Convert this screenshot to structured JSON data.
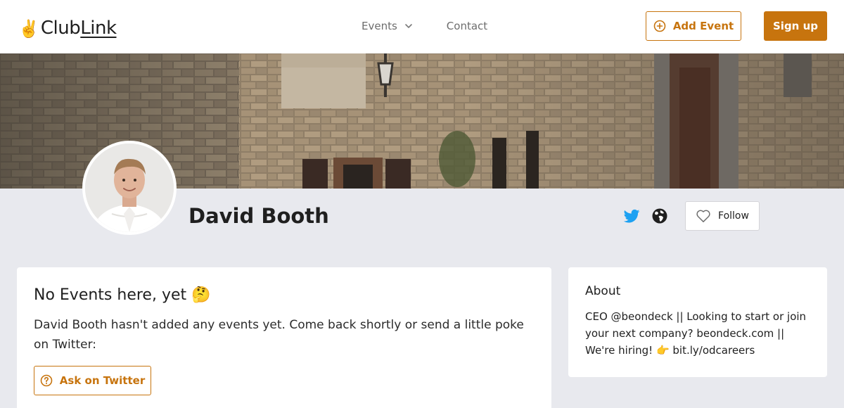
{
  "header": {
    "logo_mark": "✌️",
    "logo_part1": "Club",
    "logo_part2": "Link",
    "nav": {
      "events": "Events",
      "contact": "Contact"
    },
    "add_event_label": "Add Event",
    "signup_label": "Sign up"
  },
  "profile": {
    "name": "David Booth",
    "follow_label": "Follow"
  },
  "events_card": {
    "title": "No Events here, yet 🤔",
    "message": "David Booth hasn't added any events yet. Come back shortly or send a little poke on Twitter:",
    "ask_label": "Ask on Twitter"
  },
  "about_card": {
    "title": "About",
    "bio": "CEO @beondeck || Looking to start or join your next company? beondeck.com || We're hiring! 👉 bit.ly/odcareers"
  },
  "colors": {
    "accent": "#c7740e",
    "page_background": "#e8e9ee",
    "twitter_blue": "#1da1f2"
  },
  "icons": {
    "add_event": "plus-circle-icon",
    "events_chevron": "chevron-down-icon",
    "twitter": "twitter-icon",
    "website": "globe-icon",
    "follow": "heart-icon",
    "ask": "question-circle-icon"
  }
}
